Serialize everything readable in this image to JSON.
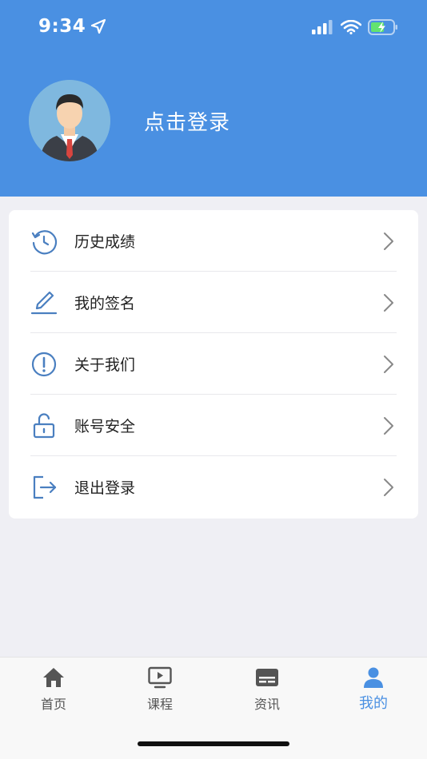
{
  "status_bar": {
    "time": "9:34"
  },
  "header": {
    "login_prompt": "点击登录"
  },
  "menu": {
    "items": [
      {
        "label": "历史成绩",
        "icon": "history-icon"
      },
      {
        "label": "我的签名",
        "icon": "pen-icon"
      },
      {
        "label": "关于我们",
        "icon": "info-icon"
      },
      {
        "label": "账号安全",
        "icon": "unlock-icon"
      },
      {
        "label": "退出登录",
        "icon": "logout-icon"
      }
    ]
  },
  "tabbar": {
    "tabs": [
      {
        "label": "首页",
        "icon": "home-icon"
      },
      {
        "label": "课程",
        "icon": "video-icon"
      },
      {
        "label": "资讯",
        "icon": "news-icon"
      },
      {
        "label": "我的",
        "icon": "person-icon",
        "active": true
      }
    ]
  },
  "colors": {
    "brand": "#4a90e2",
    "icon_accent": "#4a7fc0"
  }
}
